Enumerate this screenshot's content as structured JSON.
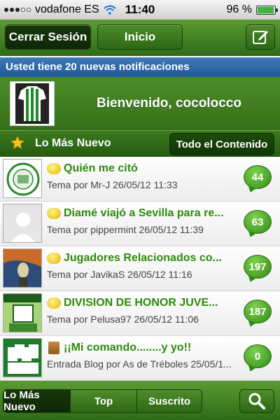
{
  "status_bar": {
    "carrier": "vodafone ES",
    "time": "11:40",
    "battery": "96 %",
    "battery_level": 0.96,
    "icons": [
      "signal-icon",
      "wifi-icon",
      "battery-icon"
    ]
  },
  "top_nav": {
    "logout_label": "Cerrar Sesión",
    "home_label": "Inicio",
    "compose_icon": "compose-icon"
  },
  "notification": {
    "text": "Usted tiene 20 nuevas notificaciones"
  },
  "welcome": {
    "text": "Bienvenido, cocolocco"
  },
  "section": {
    "title": "Lo Más Nuevo",
    "all_content_label": "Todo el Contenido",
    "icon": "star-icon"
  },
  "items": [
    {
      "title": "Quién me citó",
      "meta": "Tema por Mr-J 26/05/12 11:33",
      "count": "44",
      "type_icon": "thread-icon"
    },
    {
      "title": "Diamé viajó a Sevilla para re...",
      "meta": "Tema por pippermint 26/05/12 11:39",
      "count": "63",
      "type_icon": "thread-icon"
    },
    {
      "title": "Jugadores Relacionados co...",
      "meta": "Tema por JavikaS 26/05/12 11:16",
      "count": "197",
      "type_icon": "thread-icon"
    },
    {
      "title": "DIVISION DE HONOR JUVE...",
      "meta": "Tema por Pelusa97 26/05/12 11:06",
      "count": "187",
      "type_icon": "thread-icon"
    },
    {
      "title": "¡¡Mi comando........y yo!!",
      "meta": "Entrada Blog por As de Tréboles 25/05/1...",
      "count": "0",
      "type_icon": "blog-icon"
    }
  ],
  "bottom_tabs": {
    "latest_label": "Lo Más Nuevo",
    "top_label": "Top",
    "subscribed_label": "Suscrito",
    "search_icon": "search-icon"
  },
  "colors": {
    "nav_green": "#3f7d22",
    "title_green": "#2d8a0c",
    "notif_blue": "#2a66a6"
  }
}
